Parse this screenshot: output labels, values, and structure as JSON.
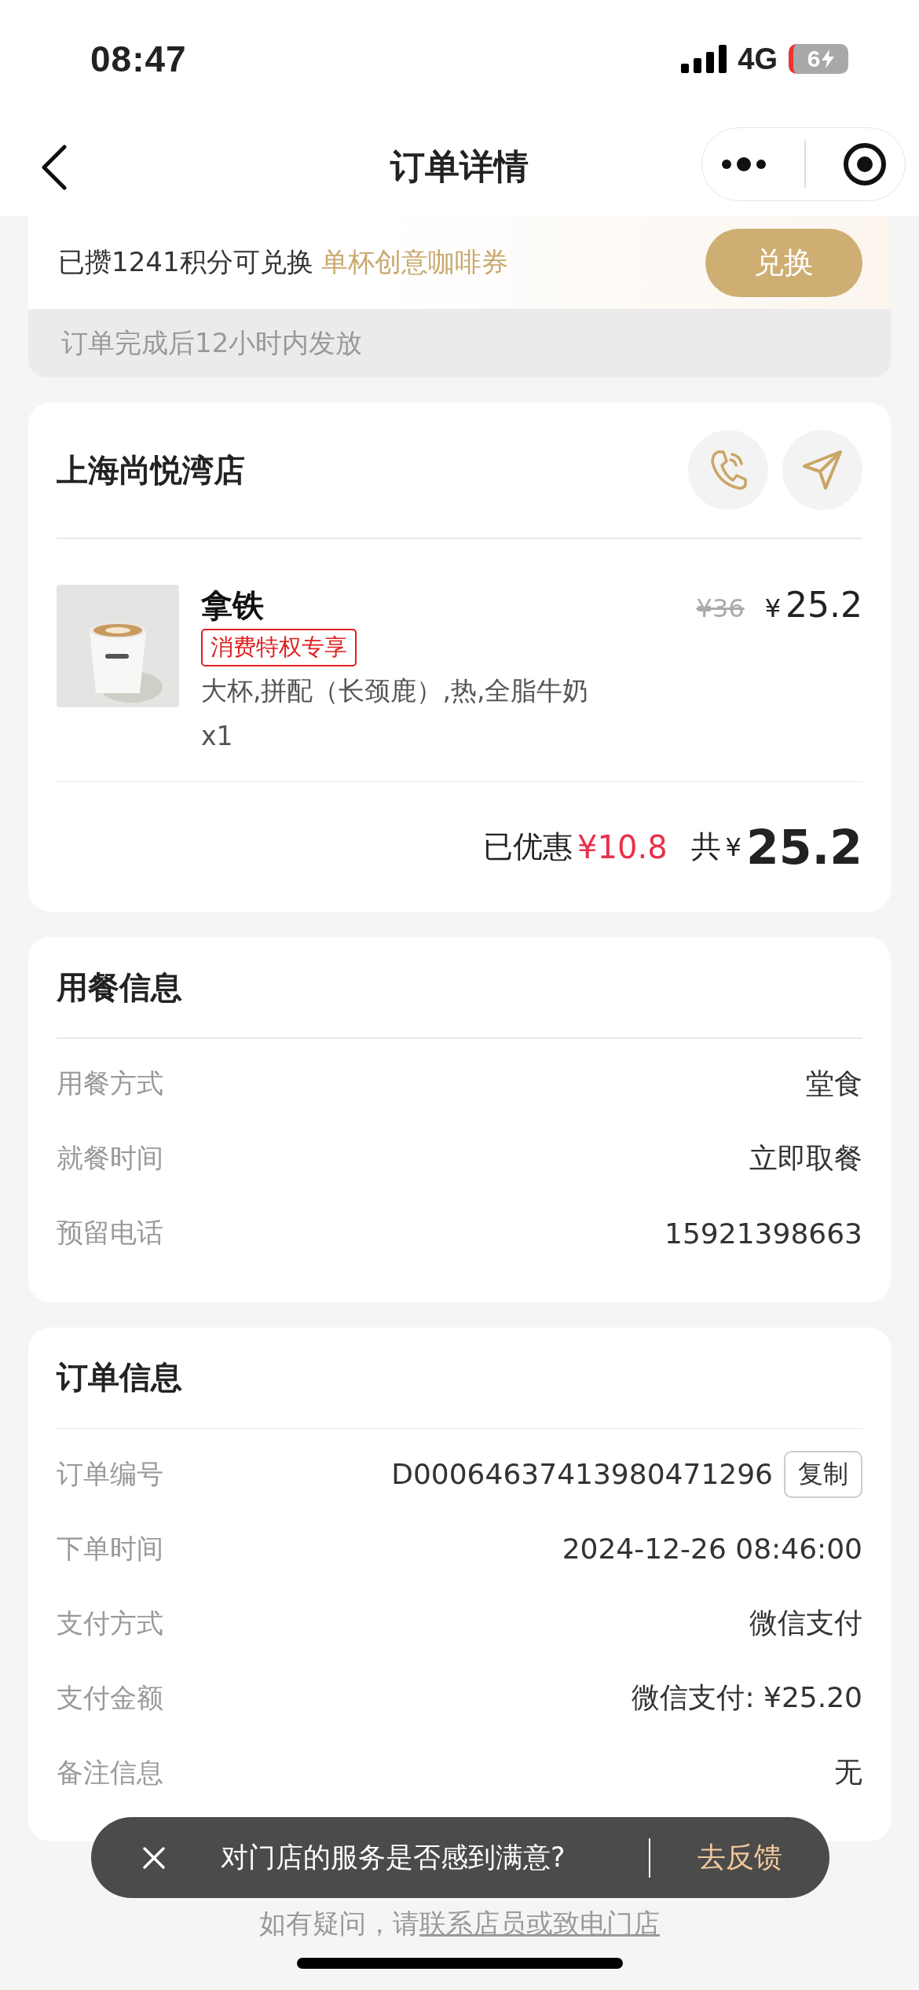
{
  "status_bar": {
    "time": "08:47",
    "network": "4G",
    "battery": "6"
  },
  "nav": {
    "title": "订单详情"
  },
  "points_banner": {
    "text": "已攒1241积分可兑换",
    "reward": "单杯创意咖啡券",
    "button": "兑换",
    "note": "订单完成后12小时内发放"
  },
  "store": {
    "name": "上海尚悦湾店",
    "items": [
      {
        "name": "拿铁",
        "tag": "消费特权专享",
        "specs": "大杯,拼配（长颈鹿）,热,全脂牛奶",
        "quantity": "x1",
        "original_price": "¥36",
        "currency": "¥",
        "price": "25.2"
      }
    ],
    "discount_label": "已优惠",
    "discount": "¥10.8",
    "total_label": "共",
    "total_currency": "¥",
    "total": "25.2"
  },
  "dining_info": {
    "title": "用餐信息",
    "rows": [
      {
        "label": "用餐方式",
        "value": "堂食"
      },
      {
        "label": "就餐时间",
        "value": "立即取餐"
      },
      {
        "label": "预留电话",
        "value": "15921398663"
      }
    ]
  },
  "order_info": {
    "title": "订单信息",
    "rows": [
      {
        "label": "订单编号",
        "value": "D00064637413980471296",
        "action": "复制"
      },
      {
        "label": "下单时间",
        "value": "2024-12-26 08:46:00"
      },
      {
        "label": "支付方式",
        "value": "微信支付"
      },
      {
        "label": "支付金额",
        "value": "微信支付: ¥25.20"
      },
      {
        "label": "备注信息",
        "value": "无"
      }
    ]
  },
  "toast": {
    "message": "对门店的服务是否感到满意?",
    "action": "去反馈"
  },
  "footer": {
    "text": "如有疑问，请",
    "link": "联系店员或致电门店"
  }
}
